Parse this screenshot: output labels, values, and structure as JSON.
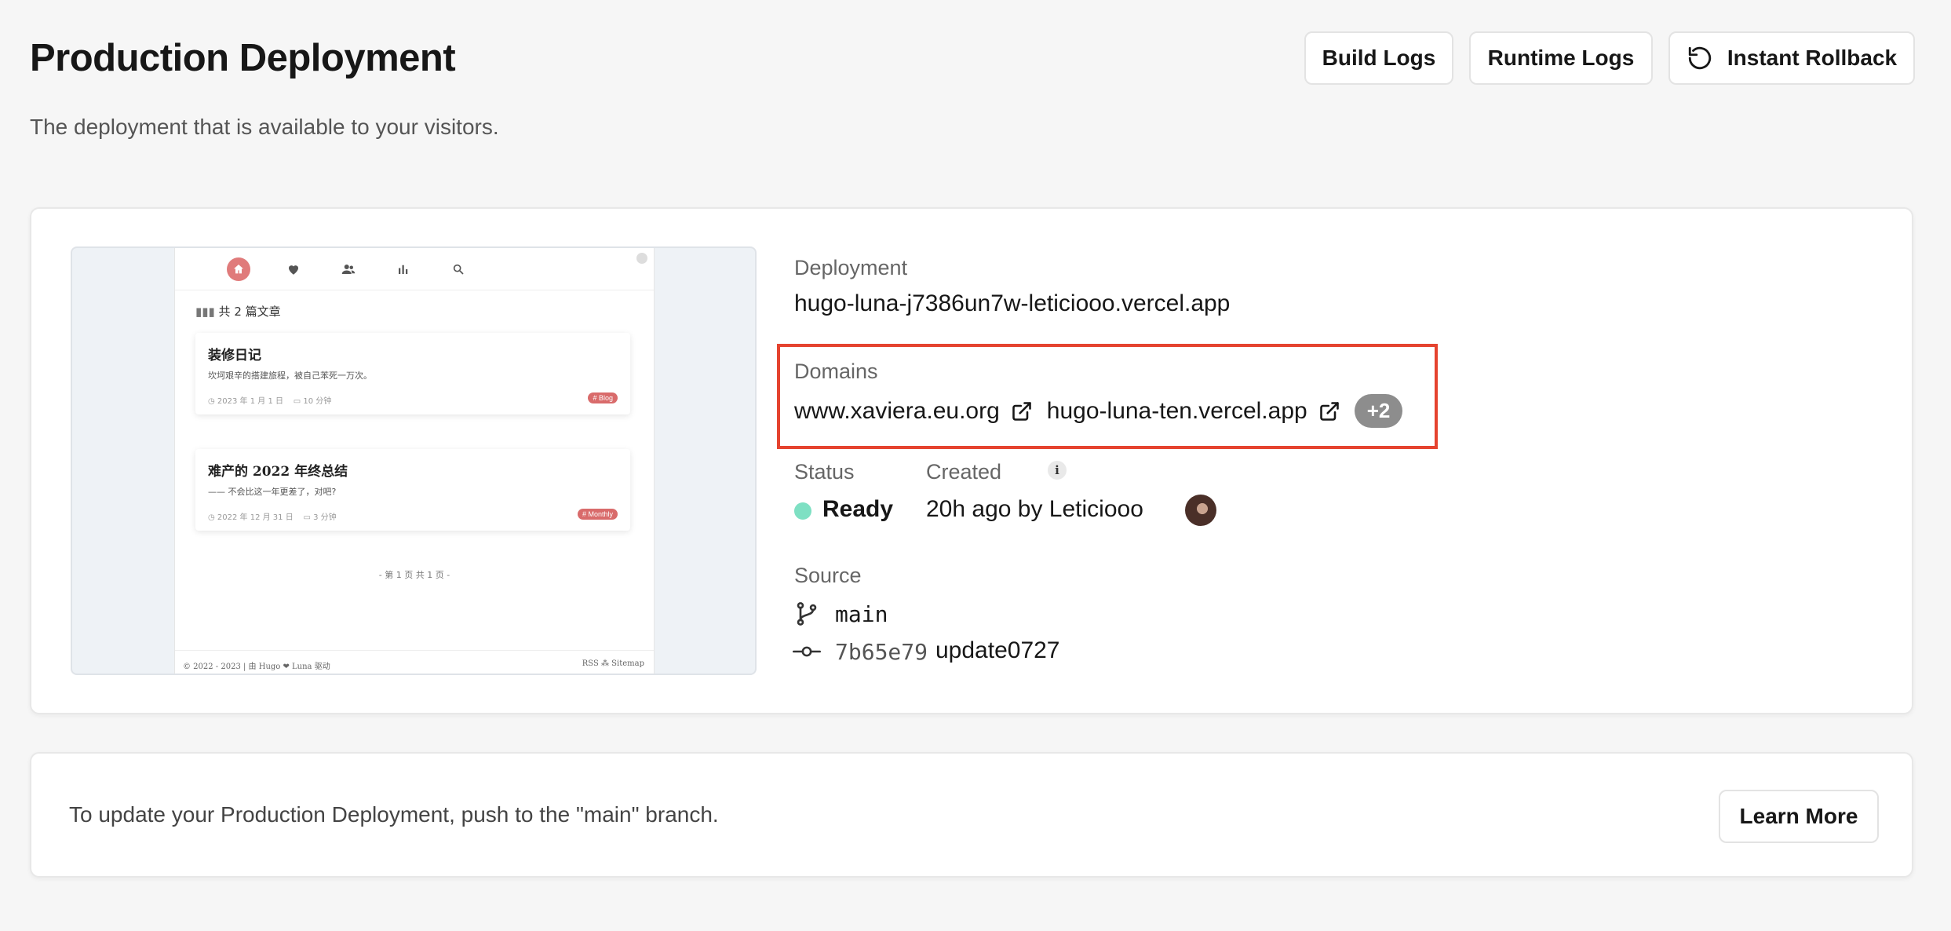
{
  "header": {
    "title": "Production Deployment",
    "subtitle": "The deployment that is available to your visitors.",
    "buttons": {
      "build_logs": "Build Logs",
      "runtime_logs": "Runtime Logs",
      "instant_rollback": "Instant Rollback"
    }
  },
  "preview": {
    "post_count_prefix": "共",
    "post_count": "2",
    "post_count_suffix": "篇文章",
    "posts": [
      {
        "title": "装修日记",
        "excerpt": "坎坷艰辛的搭建旅程，被自己苯死一万次。",
        "date": "2023 年 1 月 1 日",
        "read_time": "10 分钟",
        "tag": "# Blog"
      },
      {
        "title": "难产的 2022 年终总结",
        "excerpt": "—— 不会比这一年更差了，对吧?",
        "date": "2022 年 12 月 31 日",
        "read_time": "3 分钟",
        "tag": "# Monthly"
      }
    ],
    "pager": "- 第 1 页 共 1 页 -",
    "footer_left": "© 2022 - 2023 | 由 Hugo ❤ Luna 驱动",
    "footer_right": "RSS ⁂ Sitemap"
  },
  "deployment": {
    "label": "Deployment",
    "url": "hugo-luna-j7386un7w-leticiooo.vercel.app"
  },
  "domains": {
    "label": "Domains",
    "items": [
      "www.xaviera.eu.org",
      "hugo-luna-ten.vercel.app"
    ],
    "more": "+2"
  },
  "status": {
    "label": "Status",
    "value": "Ready",
    "color": "#7ee0c3"
  },
  "created": {
    "label": "Created",
    "info_icon": "i",
    "value": "20h ago by Leticiooo"
  },
  "source": {
    "label": "Source",
    "branch": "main",
    "commit_hash": "7b65e79",
    "commit_message": "update0727"
  },
  "footer": {
    "text": "To update your Production Deployment, push to the \"main\" branch.",
    "learn_more": "Learn More"
  },
  "colors": {
    "highlight_border": "#e5432f",
    "preview_accent": "#e07b7b"
  }
}
